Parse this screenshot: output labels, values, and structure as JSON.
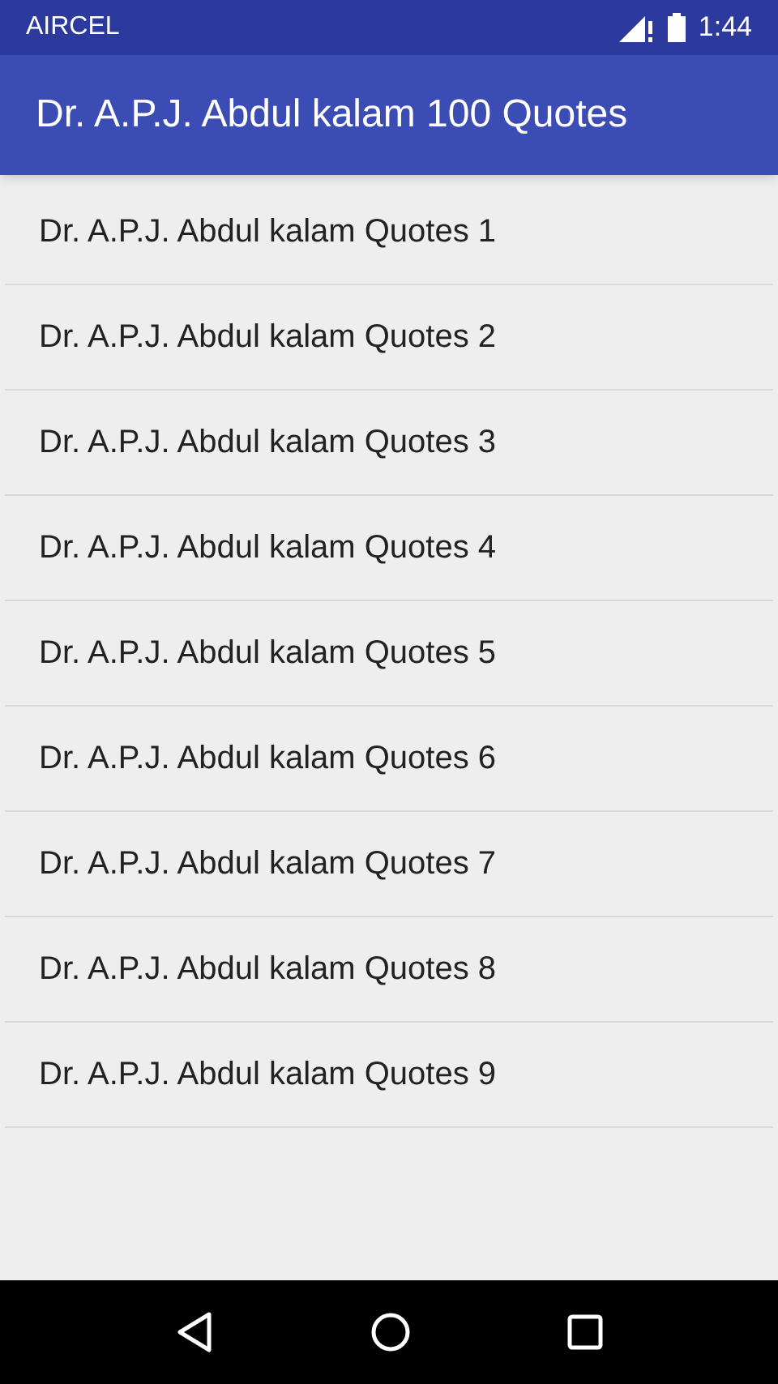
{
  "status_bar": {
    "carrier": "AIRCEL",
    "time": "1:44"
  },
  "app_bar": {
    "title": "Dr. A.P.J. Abdul kalam 100 Quotes"
  },
  "list": [
    {
      "label": "Dr. A.P.J. Abdul kalam Quotes 1"
    },
    {
      "label": "Dr. A.P.J. Abdul kalam Quotes 2"
    },
    {
      "label": "Dr. A.P.J. Abdul kalam Quotes 3"
    },
    {
      "label": "Dr. A.P.J. Abdul kalam Quotes 4"
    },
    {
      "label": "Dr. A.P.J. Abdul kalam Quotes 5"
    },
    {
      "label": "Dr. A.P.J. Abdul kalam Quotes 6"
    },
    {
      "label": "Dr. A.P.J. Abdul kalam Quotes 7"
    },
    {
      "label": "Dr. A.P.J. Abdul kalam Quotes 8"
    },
    {
      "label": "Dr. A.P.J. Abdul kalam Quotes 9"
    }
  ]
}
